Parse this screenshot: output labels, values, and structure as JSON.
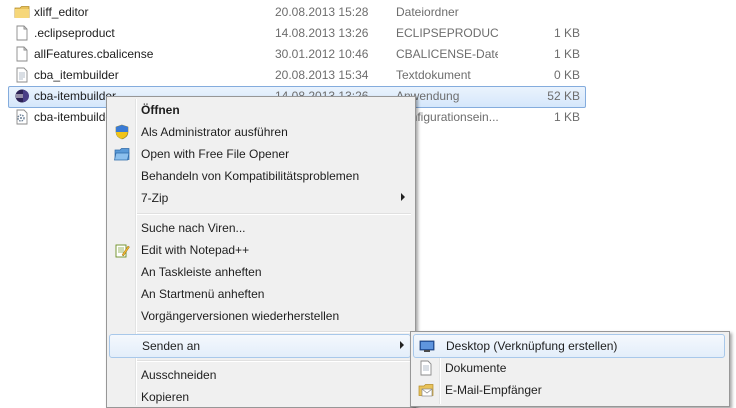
{
  "files": [
    {
      "name": "xliff_editor",
      "date": "20.08.2013 15:28",
      "type": "Dateiordner",
      "size": "",
      "icon": "folder-icon"
    },
    {
      "name": ".eclipseproduct",
      "date": "14.08.2013 13:26",
      "type": "ECLIPSEPRODUCT...",
      "size": "1 KB",
      "icon": "document-icon"
    },
    {
      "name": "allFeatures.cbalicense",
      "date": "30.01.2012 10:46",
      "type": "CBALICENSE-Datei",
      "size": "1 KB",
      "icon": "document-icon"
    },
    {
      "name": "cba_itembuilder",
      "date": "20.08.2013 15:34",
      "type": "Textdokument",
      "size": "0 KB",
      "icon": "text-document-icon"
    },
    {
      "name": "cba-itembuilder",
      "date": "14.08.2013 13:26",
      "type": "Anwendung",
      "size": "52 KB",
      "icon": "eclipse-app-icon"
    },
    {
      "name": "cba-itembuilder",
      "date": "",
      "type": "Konfigurationsein...",
      "size": "1 KB",
      "icon": "config-file-icon"
    }
  ],
  "context_menu": {
    "items": [
      {
        "label": "Öffnen",
        "bold": true,
        "icon": ""
      },
      {
        "label": "Als Administrator ausführen",
        "icon": "uac-shield-icon"
      },
      {
        "label": "Open with Free File Opener",
        "icon": "file-opener-icon"
      },
      {
        "label": "Behandeln von Kompatibilitätsproblemen",
        "icon": ""
      },
      {
        "label": "7-Zip",
        "submenu": true,
        "icon": ""
      },
      {
        "label": "Suche nach Viren...",
        "icon": ""
      },
      {
        "label": "Edit with Notepad++",
        "icon": "notepad-plus-plus-icon"
      },
      {
        "label": "An Taskleiste anheften",
        "icon": ""
      },
      {
        "label": "An Startmenü anheften",
        "icon": ""
      },
      {
        "label": "Vorgängerversionen wiederherstellen",
        "icon": ""
      },
      {
        "label": "Senden an",
        "submenu": true,
        "icon": ""
      },
      {
        "label": "Ausschneiden",
        "icon": ""
      },
      {
        "label": "Kopieren",
        "icon": ""
      }
    ]
  },
  "send_to_menu": {
    "items": [
      {
        "label": "Desktop (Verknüpfung erstellen)",
        "icon": "desktop-icon"
      },
      {
        "label": "Dokumente",
        "icon": "documents-icon"
      },
      {
        "label": "E-Mail-Empfänger",
        "icon": "mail-recipient-icon"
      }
    ]
  }
}
